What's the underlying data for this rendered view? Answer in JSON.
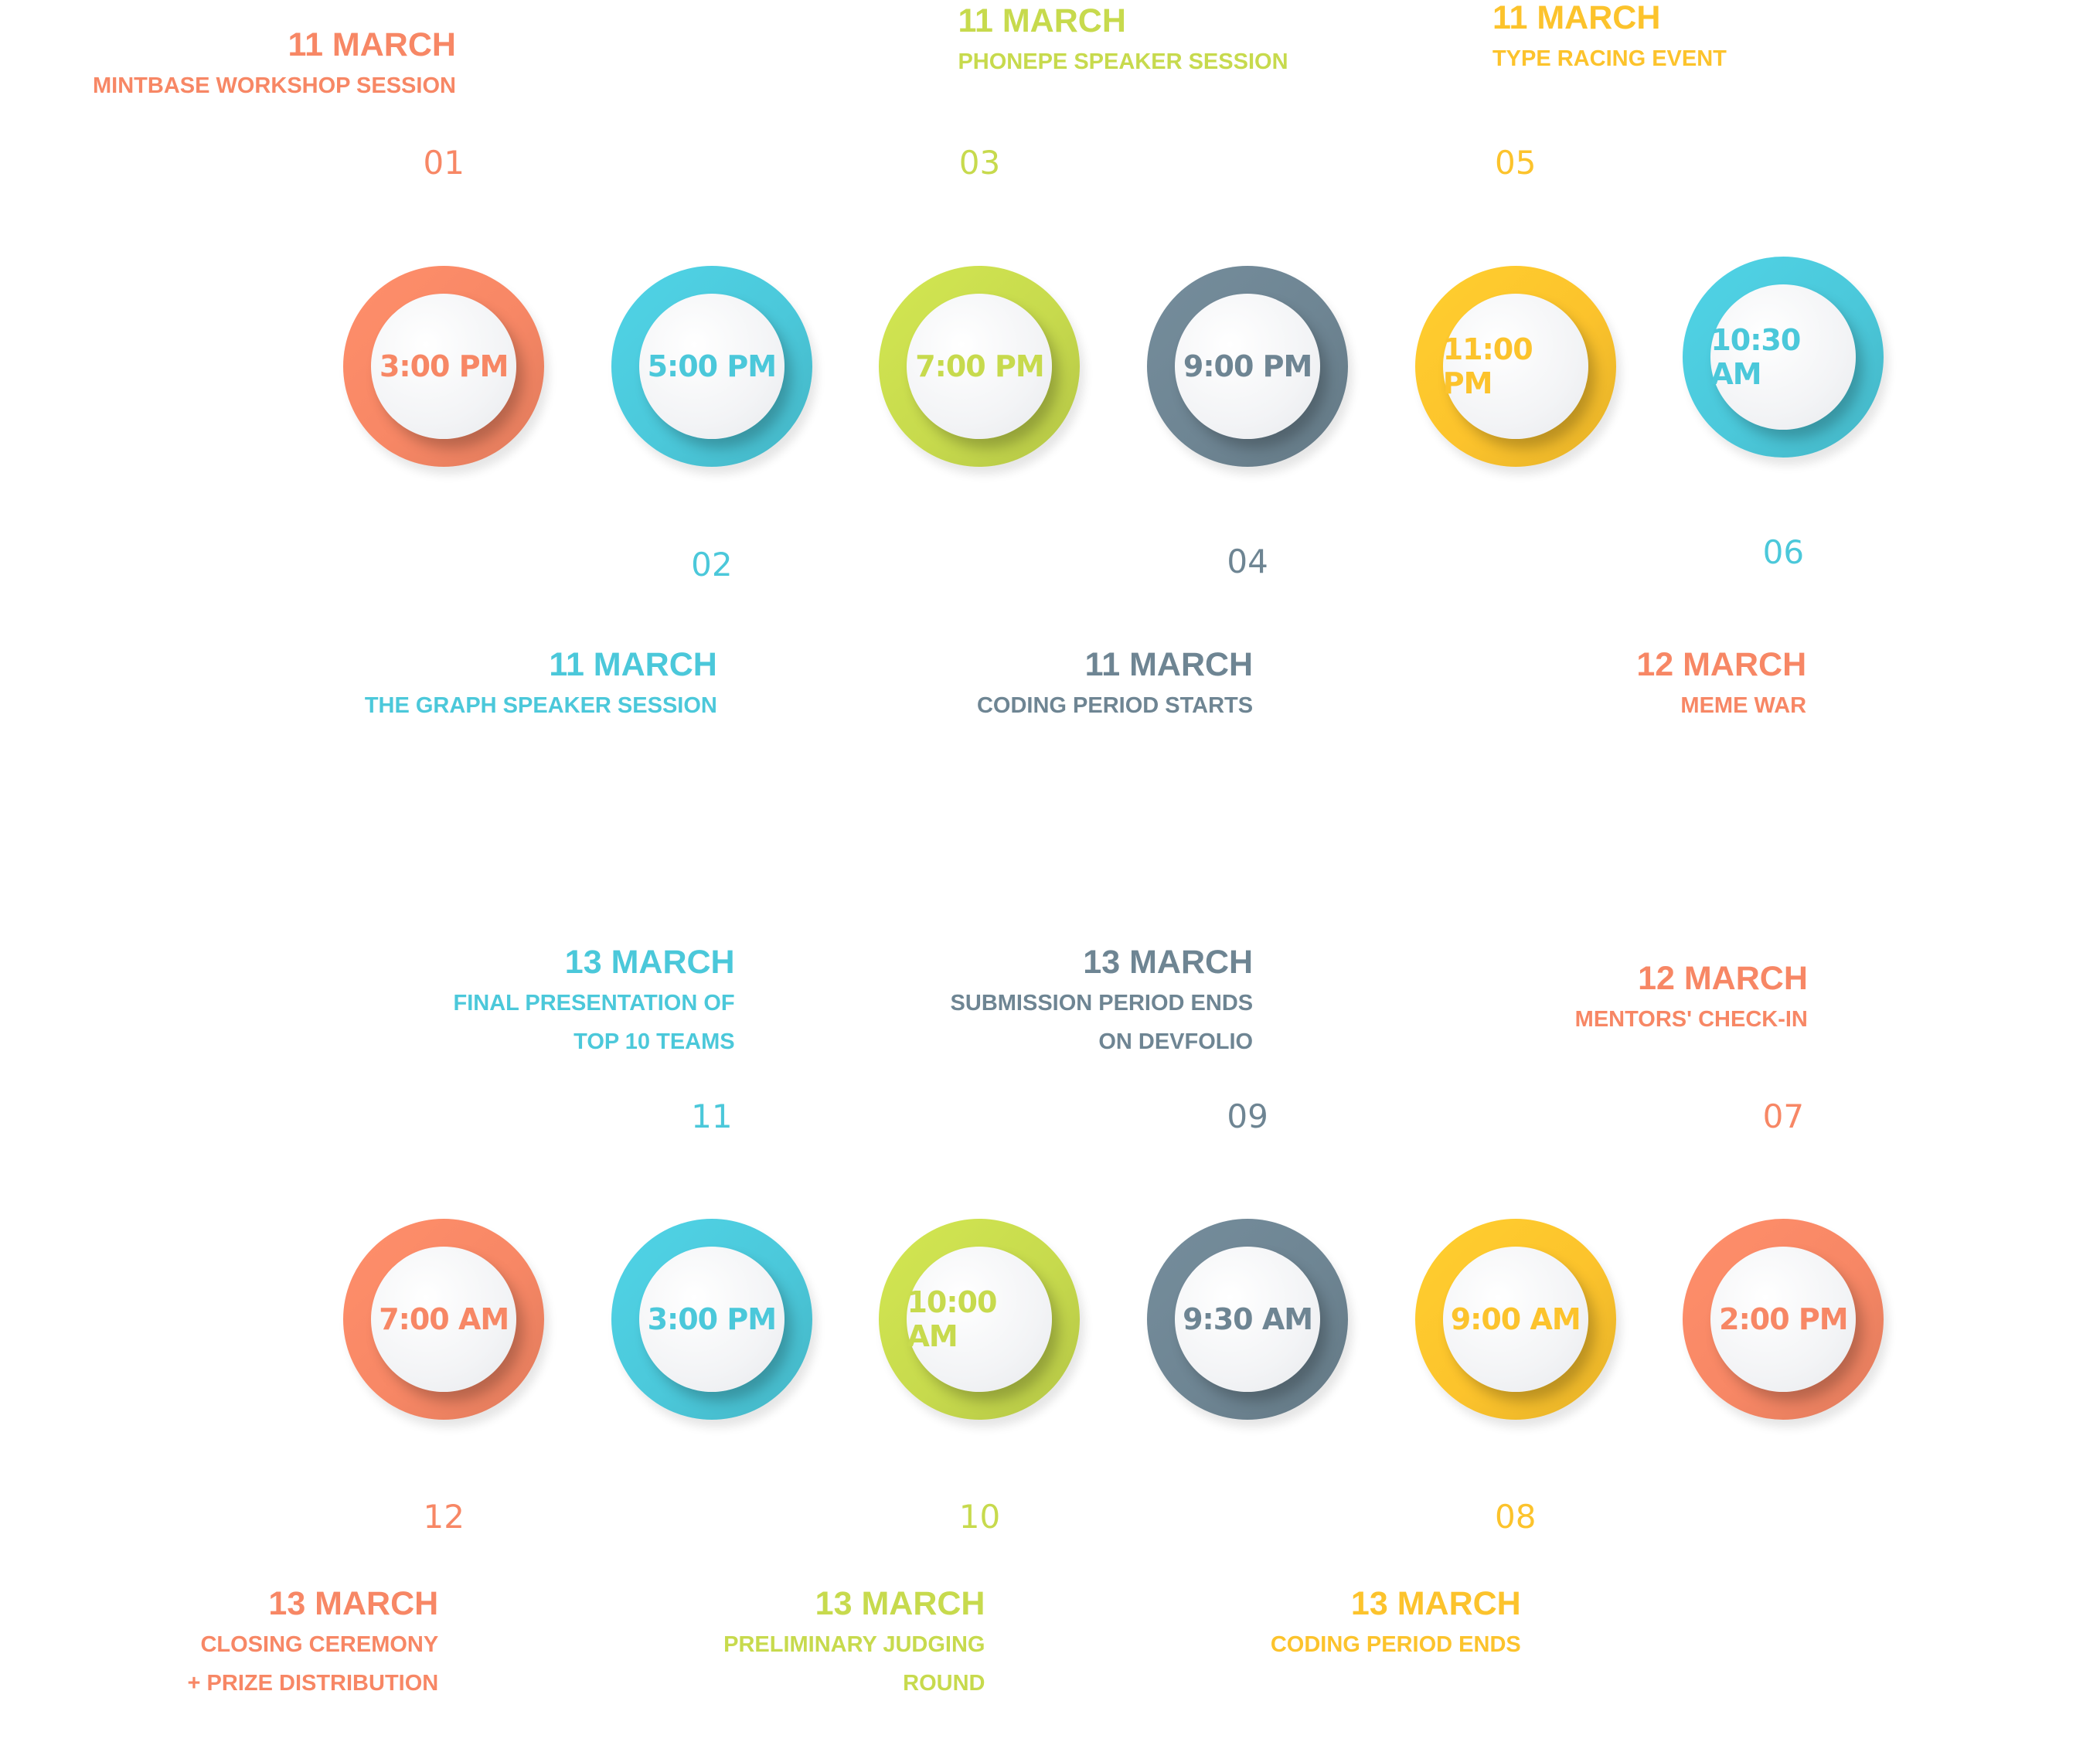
{
  "colors": {
    "coral": "#F78765",
    "cyan": "#4BC8DA",
    "lime": "#C7DA4D",
    "slate": "#6E8593",
    "amber": "#FCC32C"
  },
  "events": [
    {
      "number": "01",
      "time": "3:00 PM",
      "date": "11 MARCH",
      "title": [
        "MINTBASE WORKSHOP SESSION"
      ],
      "color": "#F78765"
    },
    {
      "number": "02",
      "time": "5:00 PM",
      "date": "11 MARCH",
      "title": [
        "THE GRAPH SPEAKER SESSION"
      ],
      "color": "#4BC8DA"
    },
    {
      "number": "03",
      "time": "7:00 PM",
      "date": "11 MARCH",
      "title": [
        "PHONEPE SPEAKER SESSION"
      ],
      "color": "#C7DA4D"
    },
    {
      "number": "04",
      "time": "9:00 PM",
      "date": "11 MARCH",
      "title": [
        "CODING PERIOD STARTS"
      ],
      "color": "#6E8593"
    },
    {
      "number": "05",
      "time": "11:00 PM",
      "date": "11 MARCH",
      "title": [
        "TYPE RACING EVENT"
      ],
      "color": "#FCC32C"
    },
    {
      "number": "06",
      "time": "10:30 AM",
      "date": "12 MARCH",
      "title": [
        "MEME WAR"
      ],
      "color": "#4BC8DA",
      "date_color": "#F78765"
    },
    {
      "number": "07",
      "time": "2:00 PM",
      "date": "12 MARCH",
      "title": [
        "MENTORS' CHECK-IN"
      ],
      "color": "#F78765"
    },
    {
      "number": "08",
      "time": "9:00 AM",
      "date": "13 MARCH",
      "title": [
        "CODING PERIOD ENDS"
      ],
      "color": "#FCC32C"
    },
    {
      "number": "09",
      "time": "9:30 AM",
      "date": "13 MARCH",
      "title": [
        "SUBMISSION PERIOD ENDS",
        "ON DEVFOLIO"
      ],
      "color": "#6E8593"
    },
    {
      "number": "10",
      "time": "10:00 AM",
      "date": "13 MARCH",
      "title": [
        "PRELIMINARY JUDGING",
        "ROUND"
      ],
      "color": "#C7DA4D"
    },
    {
      "number": "11",
      "time": "3:00 PM",
      "date": "13 MARCH",
      "title": [
        "FINAL PRESENTATION OF",
        "TOP 10 TEAMS"
      ],
      "color": "#4BC8DA"
    },
    {
      "number": "12",
      "time": "7:00 AM",
      "date": "13 MARCH",
      "title": [
        "CLOSING CEREMONY",
        "+ PRIZE DISTRIBUTION"
      ],
      "color": "#F78765"
    }
  ]
}
